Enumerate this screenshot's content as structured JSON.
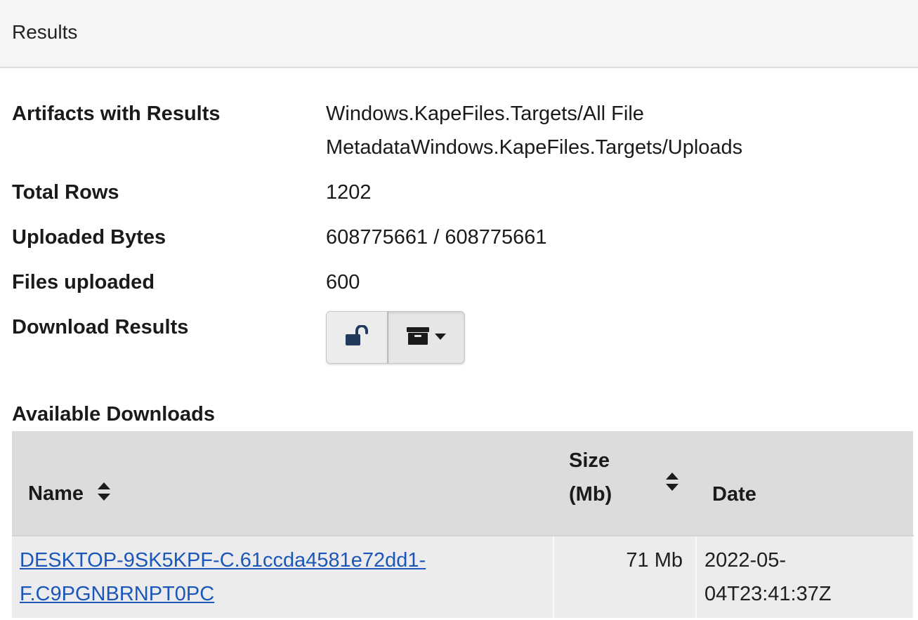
{
  "header": {
    "title": "Results"
  },
  "info": {
    "artifacts_label": "Artifacts with Results",
    "artifacts_line1": "Windows.KapeFiles.Targets/All File",
    "artifacts_line2": "MetadataWindows.KapeFiles.Targets/Uploads",
    "total_rows_label": "Total Rows",
    "total_rows_value": "1202",
    "uploaded_bytes_label": "Uploaded Bytes",
    "uploaded_bytes_value": "608775661 / 608775661",
    "files_uploaded_label": "Files uploaded",
    "files_uploaded_value": "600",
    "download_results_label": "Download Results",
    "download_buttons": [
      {
        "icon": "unlock-icon"
      },
      {
        "icon": "archive-icon",
        "dropdown": true
      }
    ]
  },
  "downloads": {
    "title": "Available Downloads",
    "columns": {
      "name": "Name",
      "size_line1": "Size",
      "size_line2": "(Mb)",
      "date": "Date"
    },
    "rows": [
      {
        "name_line1": "DESKTOP-9SK5KPF-C.61ccda4581e72dd1-",
        "name_line2": "F.C9PGNBRNPT0PC",
        "size": "71 Mb",
        "date_line1": "2022-05-",
        "date_line2": "04T23:41:37Z"
      }
    ]
  },
  "colors": {
    "link": "#1a57b8",
    "header_bg": "#f5f5f5",
    "table_head_bg": "#dcdcde",
    "table_row_bg": "#ececee"
  }
}
